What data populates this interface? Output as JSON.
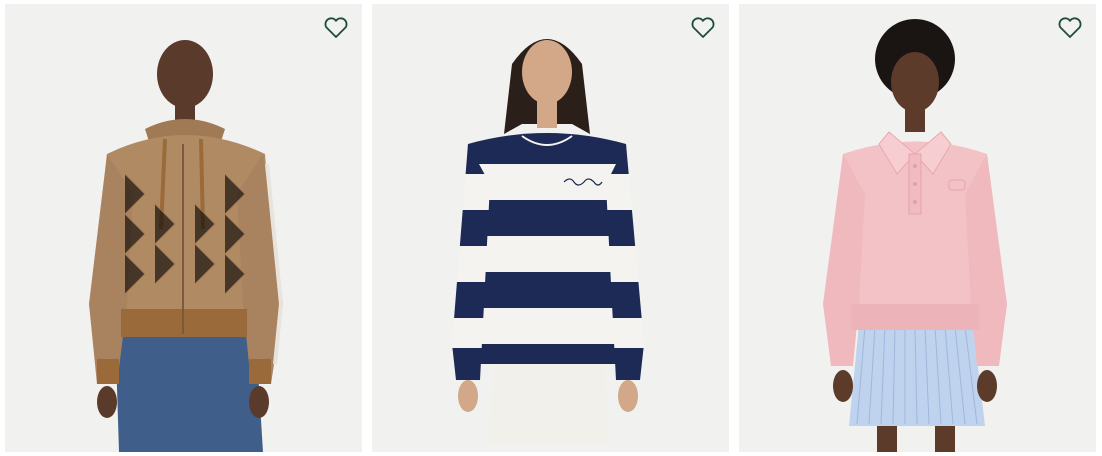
{
  "products": [
    {
      "id": "p1",
      "wishlist_icon": "heart-outline-icon",
      "colors": {
        "garment": "#b08a63",
        "trim": "#9a6a3a",
        "pants": "#3f5f8a",
        "skin": "#5a3a2a"
      }
    },
    {
      "id": "p2",
      "wishlist_icon": "heart-outline-icon",
      "colors": {
        "navy": "#1c2a55",
        "white": "#f4f3ef",
        "skirt": "#f2f0ea",
        "skin": "#d2a888",
        "hair": "#2b1f1a"
      }
    },
    {
      "id": "p3",
      "wishlist_icon": "heart-outline-icon",
      "colors": {
        "garment": "#f3c2c6",
        "skirt": "#bfd3ee",
        "skin": "#5c3b2b",
        "hair": "#1a1412"
      }
    }
  ],
  "accent_color": "#1e4d3a"
}
